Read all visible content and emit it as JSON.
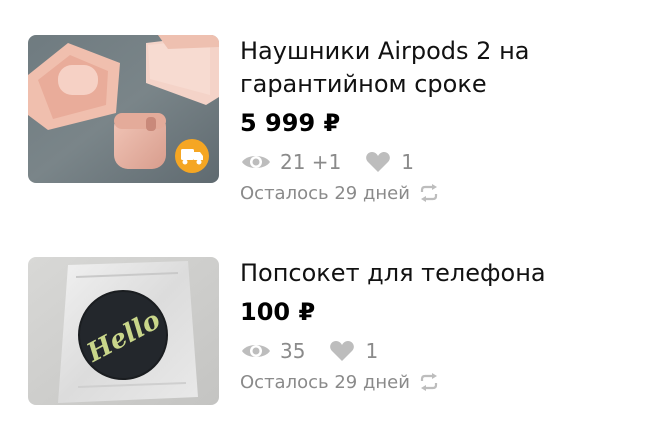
{
  "listings": [
    {
      "title_line1": "Наушники Airpods 2 на",
      "title_line2": "гарантийном сроке",
      "price": "5 999 ₽",
      "views": "21 +1",
      "favorites": "1",
      "remaining": "Осталось 29 дней",
      "delivery_badge_color": "#f5a623",
      "thumb_icon": "delivery-truck-icon"
    },
    {
      "title_line1": "Попсокет для телефона",
      "price": "100 ₽",
      "views": "35",
      "favorites": "1",
      "remaining": "Осталось 29 дней",
      "image_text": "Hello"
    }
  ],
  "colors": {
    "meta_gray": "#8a8a8a",
    "icon_gray": "#bdbdbd",
    "badge_orange": "#f5a623"
  }
}
